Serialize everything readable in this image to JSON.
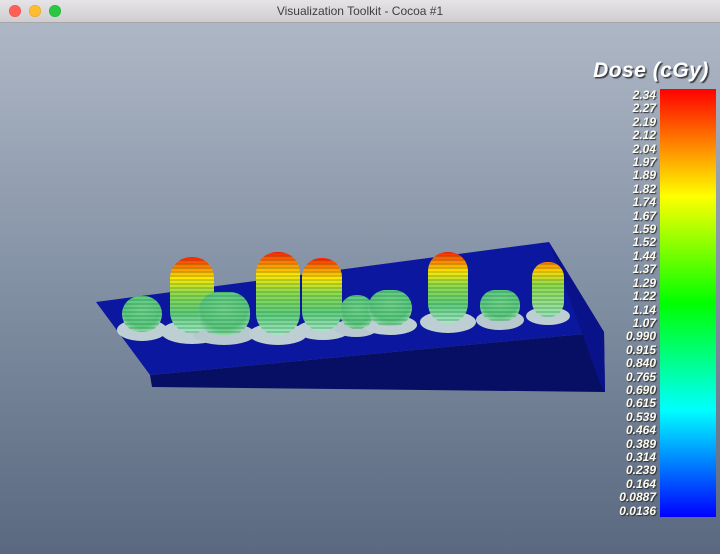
{
  "window": {
    "title": "Visualization Toolkit - Cocoa #1",
    "traffic_lights": {
      "close_color": "#ff5f57",
      "minimize_color": "#febc2e",
      "zoom_color": "#28c840"
    }
  },
  "viewport": {
    "background_top": "#aeb7c5",
    "background_bottom": "#5a6880"
  },
  "scalar_bar": {
    "title": "Dose (cGy)",
    "range": {
      "max": 2.34,
      "min": 0.0136
    },
    "labels": [
      "2.34",
      "2.27",
      "2.19",
      "2.12",
      "2.04",
      "1.97",
      "1.89",
      "1.82",
      "1.74",
      "1.67",
      "1.59",
      "1.52",
      "1.44",
      "1.37",
      "1.29",
      "1.22",
      "1.14",
      "1.07",
      "0.990",
      "0.915",
      "0.840",
      "0.765",
      "0.690",
      "0.615",
      "0.539",
      "0.464",
      "0.389",
      "0.314",
      "0.239",
      "0.164",
      "0.0887",
      "0.0136"
    ],
    "gradient_colors": [
      "#ff0000",
      "#ffff00",
      "#00ff00",
      "#00ffff",
      "#0000ff"
    ]
  },
  "scene": {
    "description": "3D dose-distribution surface: dark blue slab with banded green/yellow/red peaks",
    "slab_top_color": "#0c17a0",
    "slab_front_color": "#070f64",
    "peak_low_color": "#5ecf7d",
    "peak_mid_color": "#ffe800",
    "peak_high_color": "#ff1e00"
  }
}
